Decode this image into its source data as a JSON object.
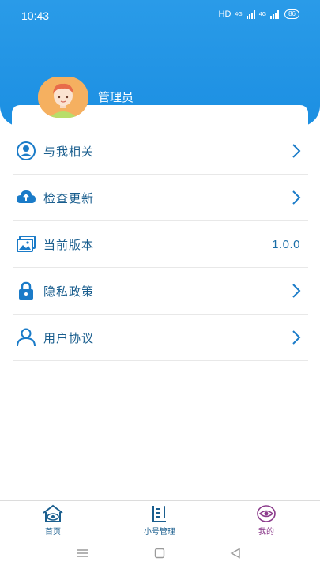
{
  "status_bar": {
    "time": "10:43",
    "network_hd": "HD",
    "signal_1": "4G",
    "signal_2": "4G",
    "battery": "86"
  },
  "profile": {
    "name": "管理员"
  },
  "menu": {
    "items": [
      {
        "label": "与我相关",
        "icon": "user-circle-icon",
        "trailing": "chevron"
      },
      {
        "label": "检查更新",
        "icon": "cloud-upload-icon",
        "trailing": "chevron"
      },
      {
        "label": "当前版本",
        "icon": "images-icon",
        "trailing": "value",
        "value": "1.0.0"
      },
      {
        "label": "隐私政策",
        "icon": "lock-icon",
        "trailing": "chevron"
      },
      {
        "label": "用户协议",
        "icon": "user-icon",
        "trailing": "chevron"
      }
    ]
  },
  "bottom_nav": {
    "items": [
      {
        "label": "首页",
        "icon": "home-eye-icon",
        "active": false
      },
      {
        "label": "小号管理",
        "icon": "document-list-icon",
        "active": false
      },
      {
        "label": "我的",
        "icon": "eye-circle-icon",
        "active": true
      }
    ]
  },
  "colors": {
    "header_blue": "#1c8fe2",
    "text_blue": "#1a5e8e",
    "active_purple": "#8b3a8b"
  }
}
